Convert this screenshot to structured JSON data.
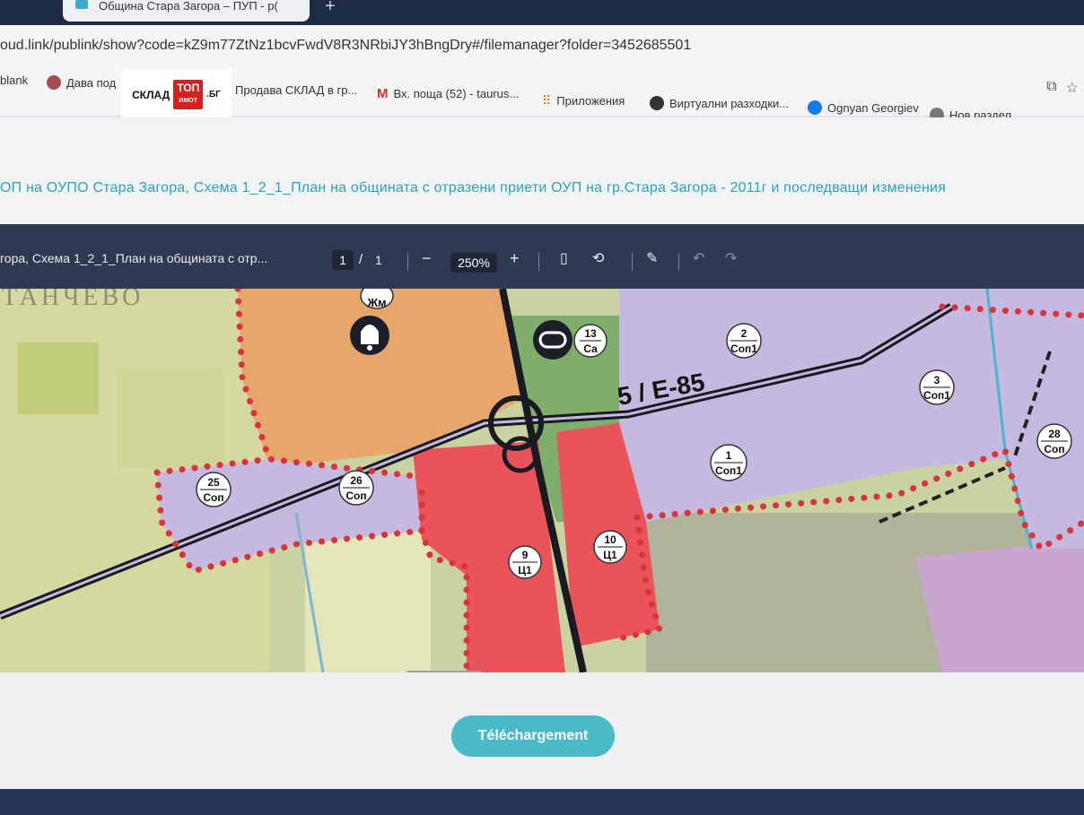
{
  "browser": {
    "tab_title": "Община Стара Загора – ПУП - р(",
    "tab_close": "×",
    "new_tab": "+",
    "url": "oud.link/publink/show?code=kZ9m77ZtNz1bcvFwdV8R3NRbiJY3hBngDry#/filemanager?folder=3452685501"
  },
  "bookmarks": [
    {
      "label": "blank",
      "icon": "blank-icon"
    },
    {
      "label": "Дава под",
      "icon": "site-icon",
      "color": "#a84d4d"
    },
    {
      "label": "Продава СКЛАД в гр...",
      "icon": "site-icon",
      "color": "#c8a040"
    },
    {
      "label": "Вх. поща (52) - taurus...",
      "icon": "gmail-icon",
      "color": "#d93025"
    },
    {
      "label": "Приложения",
      "icon": "apps-grid-icon",
      "color": "#e37400"
    },
    {
      "label": "Виртуални разходки...",
      "icon": "site-icon",
      "color": "#333333"
    },
    {
      "label": "Ognyan Georgiev",
      "icon": "facebook-icon",
      "color": "#1877f2"
    },
    {
      "label": "Нов раздел",
      "icon": "chrome-icon",
      "color": "#777777"
    }
  ],
  "watermark": {
    "left": "СКЛАД",
    "box_top": "ТОП",
    "box_bottom": "ИМОТ",
    "right": ".БГ"
  },
  "page": {
    "title": "ОП на ОУПО Стара Загора, Схема 1_2_1_План на общината с отразени приети ОУП на гр.Стара Загора - 2011г и последващи изменения"
  },
  "pdf_toolbar": {
    "file_name": "гора, Схема 1_2_1_План на общината с отр...",
    "current_page": "1",
    "page_sep": "/",
    "total_pages": "1",
    "zoom_out": "−",
    "zoom": "250%",
    "zoom_in": "+"
  },
  "map": {
    "village_label": "ТАНЧЕВО",
    "road_label": "5 / E-85",
    "zones": [
      {
        "num": "Жм",
        "code": ""
      },
      {
        "num": "13",
        "code": "Са"
      },
      {
        "num": "2",
        "code": "Соп1"
      },
      {
        "num": "3",
        "code": "Соп1"
      },
      {
        "num": "28",
        "code": "Соп"
      },
      {
        "num": "1",
        "code": "Соп1"
      },
      {
        "num": "25",
        "code": "Соп"
      },
      {
        "num": "26",
        "code": "Соп"
      },
      {
        "num": "9",
        "code": "Ц1"
      },
      {
        "num": "10",
        "code": "Ц1"
      }
    ],
    "colors": {
      "residential": "#e7a66c",
      "industrial": "#c6b9e0",
      "central": "#e8545a",
      "green": "#7fae6c",
      "boundary": "#d8343a",
      "agri": "#c9d3a2",
      "road": "#1a1a22"
    }
  },
  "download_label": "Téléchargement"
}
